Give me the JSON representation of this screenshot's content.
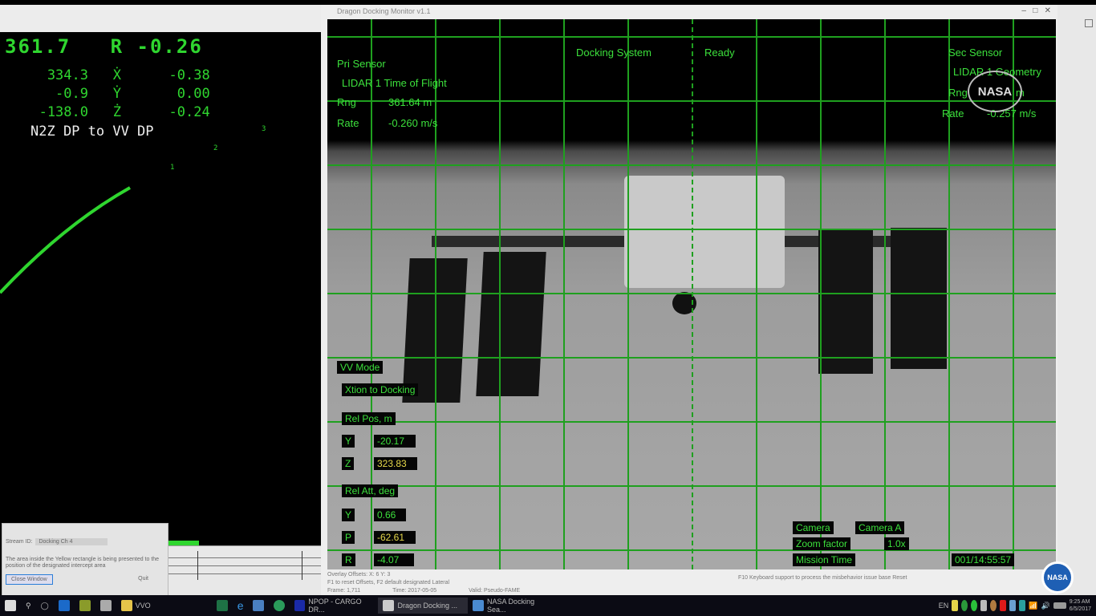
{
  "trajectory": {
    "range": "361.7",
    "range_rate_label": "R",
    "range_rate": "-0.26",
    "rows": [
      {
        "pos": "334.3",
        "axis": "Ẋ",
        "rate": "-0.38"
      },
      {
        "pos": "-0.9",
        "axis": "Ẏ",
        "rate": "0.00"
      },
      {
        "pos": "-138.0",
        "axis": "Ż",
        "rate": "-0.24"
      }
    ],
    "segment": "N2Z DP to VV DP",
    "markers": [
      "3",
      "2",
      "1"
    ]
  },
  "video_window": {
    "title": "Dragon Docking Monitor v1.1"
  },
  "hud": {
    "pri_sensor": "Pri Sensor",
    "pri_sensor_type": "LIDAR 1 Time of Flight",
    "pri_rng_label": "Rng",
    "pri_rng": "361.64 m",
    "pri_rate_label": "Rate",
    "pri_rate": "-0.260 m/s",
    "system_label": "Docking System",
    "system_status": "Ready",
    "sec_sensor": "Sec Sensor",
    "sec_sensor_type": "LIDAR 1 Geometry",
    "sec_rng_label": "Rng",
    "sec_rng": "m",
    "sec_rate_label": "Rate",
    "sec_rate": "-0.257 m/s",
    "mode": "VV Mode",
    "submode": "Xtion to Docking",
    "rel_pos_title": "Rel Pos, m",
    "rel_pos": [
      {
        "axis": "Y",
        "value": "-20.17"
      },
      {
        "axis": "Z",
        "value": "323.83"
      }
    ],
    "rel_att_title": "Rel Att, deg",
    "rel_att": [
      {
        "axis": "Y",
        "value": "0.66"
      },
      {
        "axis": "P",
        "value": "-62.61"
      },
      {
        "axis": "R",
        "value": "-4.07"
      }
    ],
    "camera_label": "Camera",
    "camera_value": "Camera A",
    "zoom_label": "Zoom factor",
    "zoom_value": "1.0x",
    "mission_time_label": "Mission Time",
    "mission_time": "001/14:55:57"
  },
  "status": {
    "overlay": "Overlay Offsets: X: 6   Y: 3",
    "note": "F1 to reset Offsets, F2 default designated Lateral",
    "frame": "Frame: 1,711",
    "time": "Time: 2017-05-05",
    "valid": "Valid: Pseudo-FAME",
    "hint": "F10 Keyboard support to process the misbehavior issue base Reset"
  },
  "dialog": {
    "stream_label": "Stream ID:",
    "stream_value": "Docking Ch 4",
    "text": "The area inside the Yellow rectangle is being presented to the position of the designated intercept area",
    "ok": "Close Window",
    "cancel": "Quit"
  },
  "logo": "NASA",
  "taskbar": {
    "items": [
      "VVO",
      "NPOP - CARGO DR...",
      "Dragon Docking ...",
      "NASA Docking Sea..."
    ],
    "tray_lang": "EN",
    "clock_time": "9:25 AM",
    "clock_date": "6/5/2017"
  }
}
